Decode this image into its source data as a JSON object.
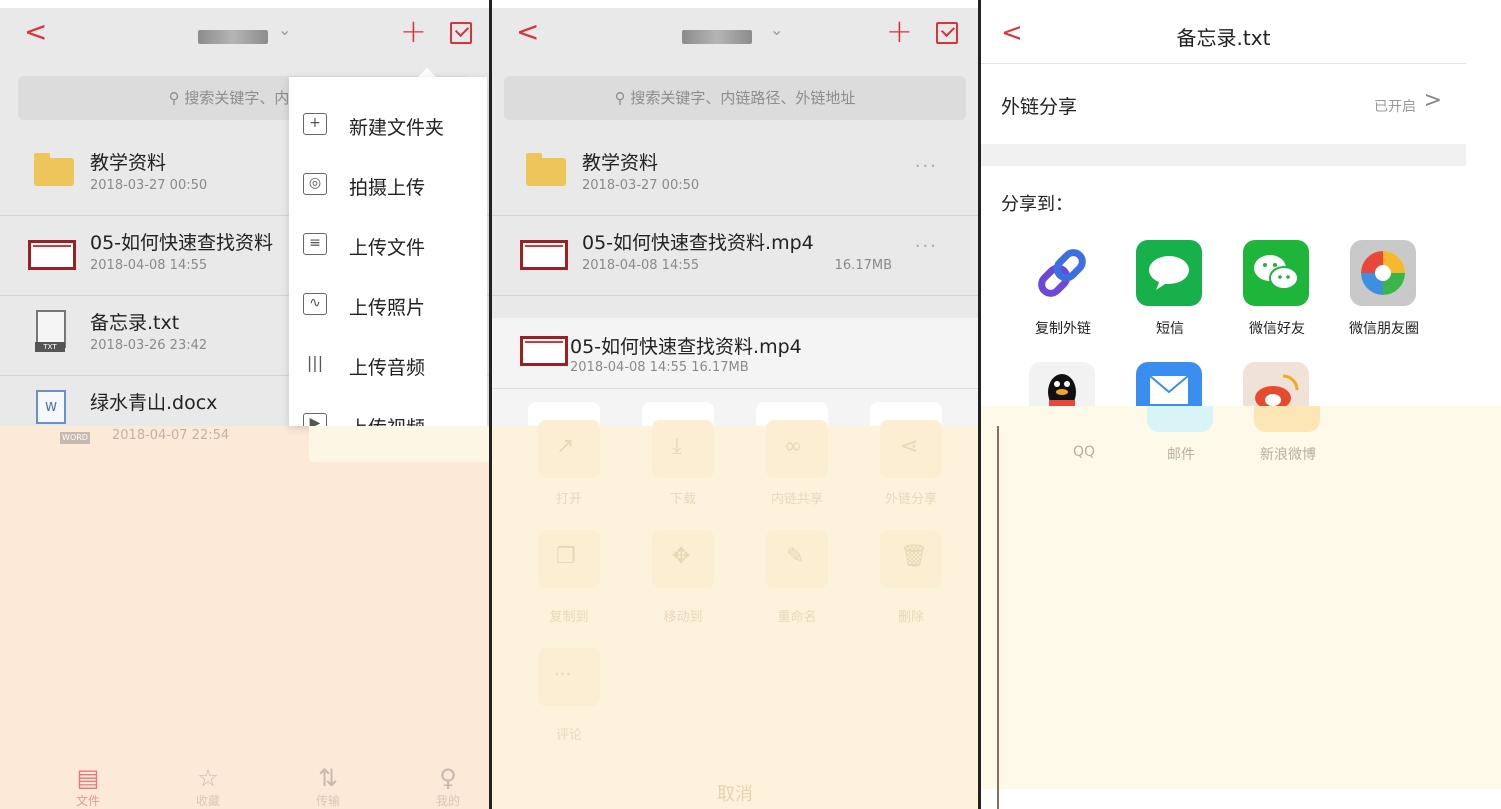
{
  "panel1": {
    "back_glyph": "<",
    "chevron_glyph": "⌄",
    "plus_glyph": "+",
    "search_placeholder": "搜索关键字、内链路",
    "files": [
      {
        "name": "教学资料",
        "date": "2018-03-27 00:50"
      },
      {
        "name": "05-如何快速查找资料",
        "date": "2018-04-08 14:55"
      },
      {
        "name": "备忘录.txt",
        "date": "2018-03-26 23:42"
      },
      {
        "name": "绿水青山.docx",
        "date": "2018-04-07 22:54"
      }
    ],
    "txt_tag": "TXT",
    "word_tag": "WORD",
    "word_glyph": "W",
    "menu": [
      {
        "label": "新建文件夹",
        "glyph": "+"
      },
      {
        "label": "拍摄上传",
        "glyph": "◎"
      },
      {
        "label": "上传文件",
        "glyph": "≡"
      },
      {
        "label": "上传照片",
        "glyph": "∿"
      },
      {
        "label": "上传音频",
        "glyph": "|||"
      },
      {
        "label": "上传视频",
        "glyph": "▶"
      }
    ],
    "tabs": [
      {
        "label": "文件",
        "glyph": "▤"
      },
      {
        "label": "收藏",
        "glyph": "☆"
      },
      {
        "label": "传输",
        "glyph": "⇅"
      },
      {
        "label": "我的",
        "glyph": "♀"
      }
    ]
  },
  "panel2": {
    "back_glyph": "<",
    "chevron_glyph": "⌄",
    "plus_glyph": "+",
    "search_placeholder": "搜索关键字、内链路径、外链地址",
    "dots": "···",
    "files": [
      {
        "name": "教学资料",
        "date": "2018-03-27 00:50"
      },
      {
        "name": "05-如何快速查找资料.mp4",
        "date": "2018-04-08 14:55",
        "size": "16.17MB"
      }
    ],
    "sheet": {
      "name": "05-如何快速查找资料.mp4",
      "meta": "2018-04-08 14:55    16.17MB"
    },
    "actions": [
      {
        "label": "打开",
        "glyph": "↗"
      },
      {
        "label": "下载",
        "glyph": "⤓"
      },
      {
        "label": "内链共享",
        "glyph": "∞"
      },
      {
        "label": "外链分享",
        "glyph": "⋖"
      },
      {
        "label": "复制到",
        "glyph": "❐"
      },
      {
        "label": "移动到",
        "glyph": "✥"
      },
      {
        "label": "重命名",
        "glyph": "✎"
      },
      {
        "label": "删除",
        "glyph": "🗑"
      },
      {
        "label": "评论",
        "glyph": "···"
      }
    ],
    "cancel": "取消"
  },
  "panel3": {
    "back_glyph": "<",
    "title": "备忘录.txt",
    "external_share_label": "外链分享",
    "external_share_status": "已开启",
    "chevron_right": ">",
    "share_to": "分享到：",
    "share_targets": [
      {
        "label": "复制外链",
        "glyph": "∞",
        "color": "#3b5bd6"
      },
      {
        "label": "短信",
        "glyph": "💬",
        "color": "#17b04a"
      },
      {
        "label": "微信好友",
        "glyph": "☺",
        "color": "#1fb53a"
      },
      {
        "label": "微信朋友圈",
        "glyph": "◉",
        "color": "#bdbdbd"
      },
      {
        "label": "QQ",
        "glyph": "🐧",
        "color": "#f2f2f2"
      },
      {
        "label": "邮件",
        "glyph": "✉",
        "color": "#3a8ef0"
      },
      {
        "label": "新浪微博",
        "glyph": "◔",
        "color": "#e64b2e"
      }
    ]
  },
  "colors": {
    "accent": "#d7343b"
  }
}
